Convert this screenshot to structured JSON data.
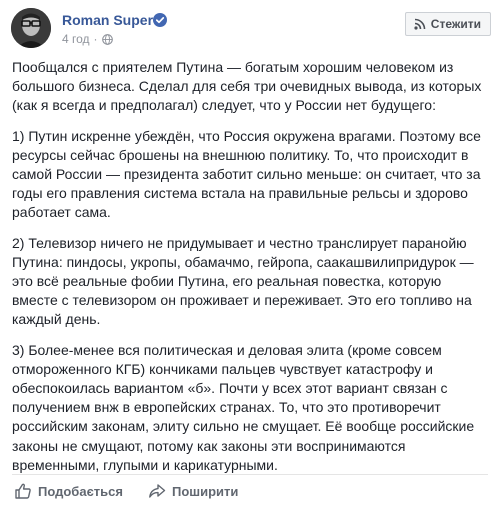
{
  "post": {
    "author": "Roman Super",
    "time": "4 год",
    "follow_label": "Стежити",
    "paragraphs": [
      "Пообщался с приятелем Путина — богатым хорошим человеком из большого бизнеса. Сделал для себя три очевидных вывода, из которых (как я всегда и предполагал) следует, что у России нет будущего:",
      "1) Путин искренне убеждён, что Россия окружена врагами. Поэтому все ресурсы сейчас брошены на внешнюю политику. То, что происходит в самой России — президента заботит сильно меньше: он считает, что за годы его правления система встала на правильные рельсы и здорово работает сама.",
      "2) Телевизор ничего не придумывает и честно транслирует паранойю Путина: пиндосы, укропы, обамачмо, гейропа, саакашвилипридурок — это всё реальные фобии Путина, его реальная повестка, которую вместе с телевизором он проживает и переживает. Это его топливо на каждый день.",
      "3) Более-менее вся политическая и деловая элита (кроме совсем отмороженного КГБ) кончиками пальцев чувствует катастрофу и обеспокоилась вариантом «б». Почти у всех этот вариант связан с получением внж в европейских странах. То, что это противоречит российским законам, элиту сильно не смущает. Её вообще российские законы не смущают, потому как законы эти воспринимаются временными, глупыми и карикатурными."
    ],
    "actions": {
      "like_label": "Подобається",
      "share_label": "Поширити"
    }
  },
  "colors": {
    "name_link": "#385898",
    "verified_badge": "#4267b2",
    "meta_text": "#90949c",
    "body_text": "#1d2129",
    "action_text": "#616770"
  },
  "icons": {
    "verified": "verified-badge-icon",
    "privacy": "globe-icon",
    "follow": "rss-icon",
    "like": "thumbs-up-icon",
    "share": "share-arrow-icon"
  }
}
